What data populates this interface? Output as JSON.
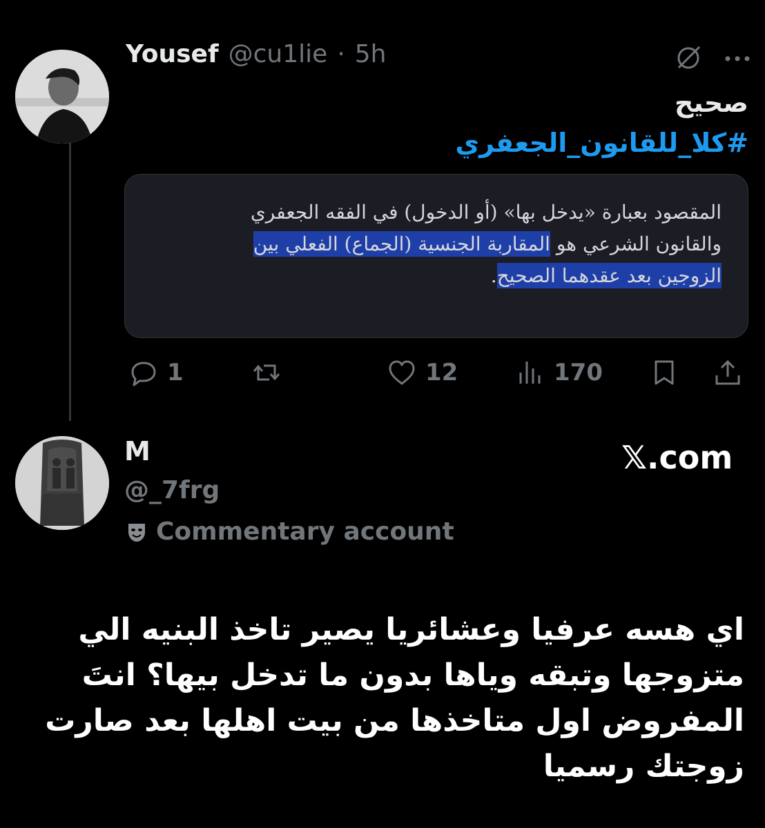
{
  "tweet": {
    "display_name": "Yousef",
    "handle": "@cu1lie",
    "separator": "·",
    "time": "5h",
    "text_line": "صحيح",
    "hashtag": "#كلا_للقانون_الجعفري",
    "media": {
      "line_1": "المقصود بعبارة «يدخل بها» (أو الدخول) في الفقه الجعفري",
      "line_2_plain": "والقانون الشرعي هو ",
      "line_2_highlight": "المقاربة الجنسية (الجماع) الفعلي بين",
      "line_3_highlight": "الزوجين بعد عقدهما الصحيح",
      "line_3_end": "."
    },
    "actions": {
      "replies": "1",
      "reposts": "",
      "likes": "12",
      "views": "170"
    },
    "icons": [
      "reply-icon",
      "repost-icon",
      "like-icon",
      "views-icon",
      "bookmark-icon",
      "share-icon",
      "grok-icon",
      "more-icon"
    ]
  },
  "quote_account": {
    "display_name": "M",
    "handle": "@_7frg",
    "label": "Commentary account",
    "label_icon": "mask-icon",
    "site": "𝕏.com"
  },
  "reply_text": "اي هسه عرفيا وعشائريا يصير تاخذ البنيه الي متزوجها وتبقه وياها بدون ما تدخل بيها؟ انتَ المفروض اول متاخذها من بيت اهلها بعد صارت زوجتك رسميا",
  "colors": {
    "background": "#000000",
    "text": "#e7e9ea",
    "secondary": "#71767b",
    "accent": "#1d9bf0",
    "highlight": "#1f3fa8"
  }
}
